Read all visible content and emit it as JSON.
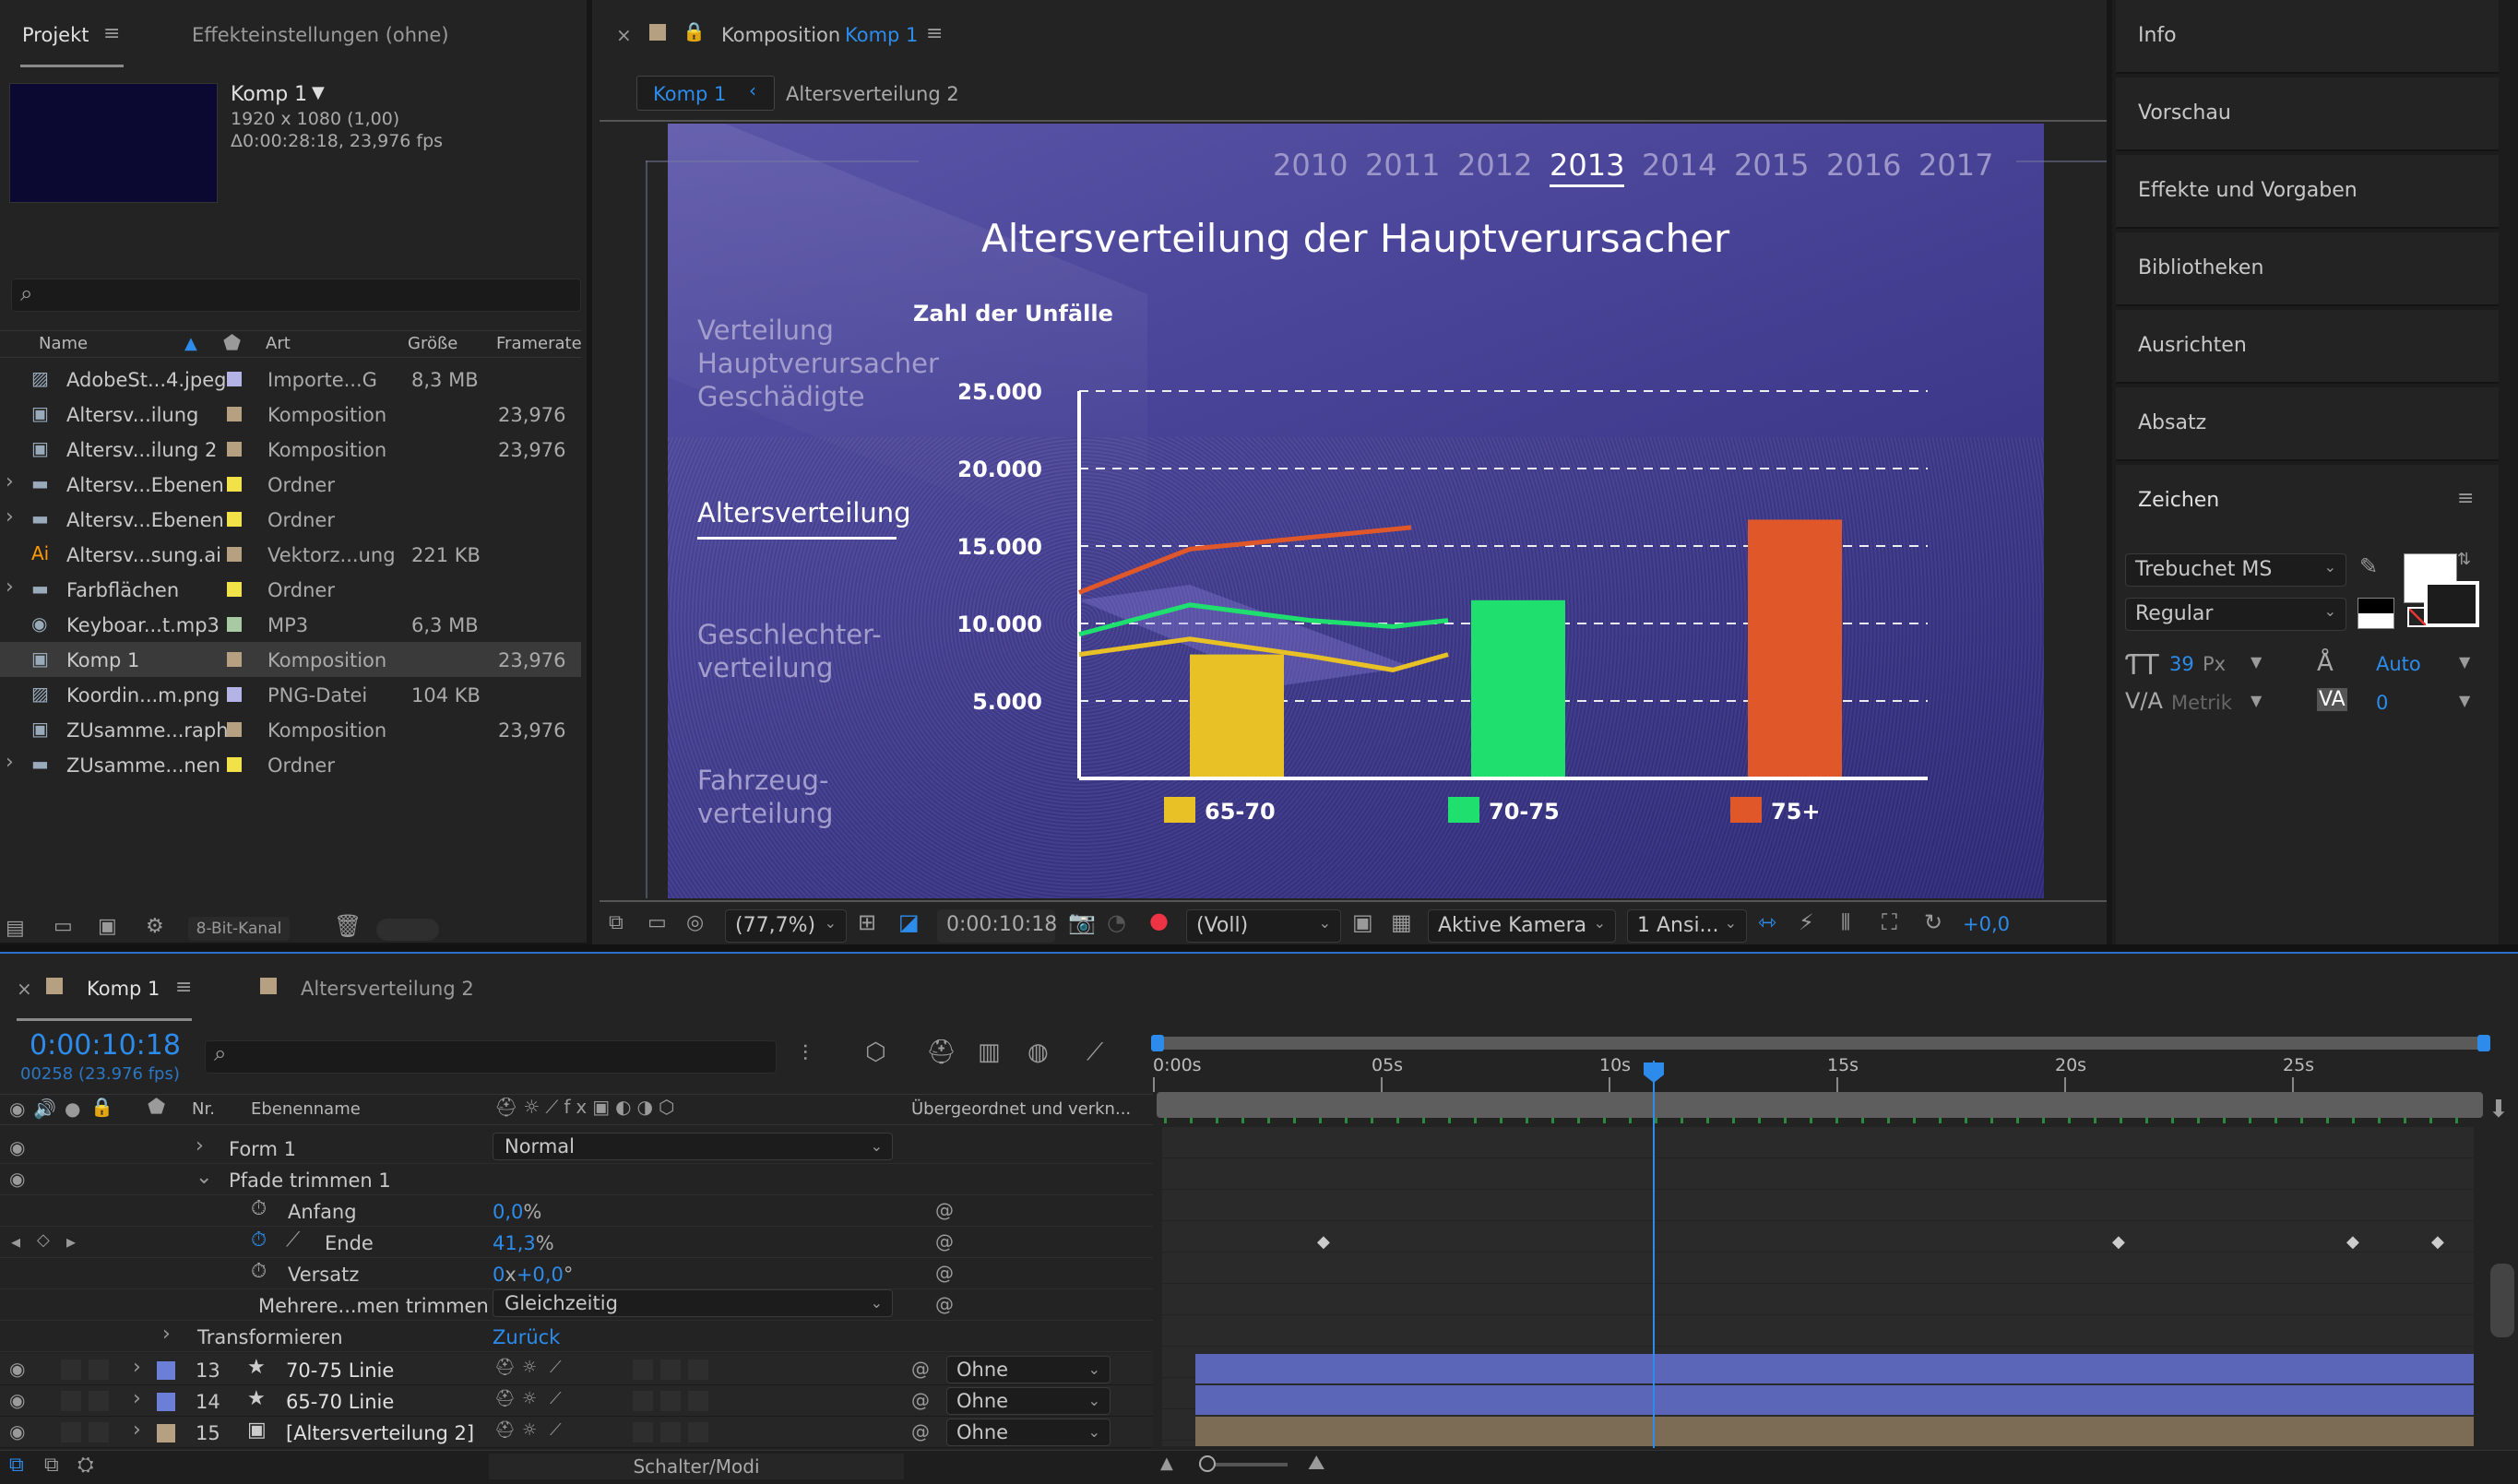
{
  "project_panel": {
    "tab_project": "Projekt",
    "tab_effects": "Effekteinstellungen (ohne)",
    "comp_name": "Komp 1",
    "comp_res": "1920 x 1080 (1,00)",
    "comp_duration": "Δ0:00:28:18, 23,976 fps",
    "columns": {
      "name": "Name",
      "type": "Art",
      "size": "Größe",
      "framerate": "Framerate"
    },
    "items": [
      {
        "name": "AdobeSt...4.jpeg",
        "type": "Importe...G",
        "size": "8,3 MB",
        "fps": "",
        "color": "#b3b3e6",
        "icon": "image-icon"
      },
      {
        "name": "Altersv...ilung",
        "type": "Komposition",
        "size": "",
        "fps": "23,976",
        "color": "#b6a082",
        "icon": "composition-icon"
      },
      {
        "name": "Altersv...ilung 2",
        "type": "Komposition",
        "size": "",
        "fps": "23,976",
        "color": "#b6a082",
        "icon": "composition-icon"
      },
      {
        "name": "Altersv...Ebenen",
        "type": "Ordner",
        "size": "",
        "fps": "",
        "color": "#f2e24a",
        "icon": "folder-icon"
      },
      {
        "name": "Altersv...Ebenen",
        "type": "Ordner",
        "size": "",
        "fps": "",
        "color": "#f2e24a",
        "icon": "folder-icon"
      },
      {
        "name": "Altersv...sung.ai",
        "type": "Vektorz...ung",
        "size": "221 KB",
        "fps": "",
        "color": "#b6a082",
        "icon": "illustrator-file-icon"
      },
      {
        "name": "Farbflächen",
        "type": "Ordner",
        "size": "",
        "fps": "",
        "color": "#f2e24a",
        "icon": "folder-icon"
      },
      {
        "name": "Keyboar...t.mp3",
        "type": "MP3",
        "size": "6,3 MB",
        "fps": "",
        "color": "#a9c9a5",
        "icon": "audio-icon"
      },
      {
        "name": "Komp 1",
        "type": "Komposition",
        "size": "",
        "fps": "23,976",
        "color": "#b6a082",
        "icon": "composition-icon"
      },
      {
        "name": "Koordin...m.png",
        "type": "PNG-Datei",
        "size": "104 KB",
        "fps": "",
        "color": "#b3b3e6",
        "icon": "image-icon"
      },
      {
        "name": "ZUsamme...raph",
        "type": "Komposition",
        "size": "",
        "fps": "23,976",
        "color": "#b6a082",
        "icon": "composition-icon"
      },
      {
        "name": "ZUsamme...nen",
        "type": "Ordner",
        "size": "",
        "fps": "",
        "color": "#f2e24a",
        "icon": "folder-icon"
      }
    ],
    "bit_depth": "8-Bit-Kanal"
  },
  "viewer": {
    "tab_label": "Komposition",
    "tab_comp": "Komp 1",
    "breadcrumb_active": "Komp 1",
    "breadcrumb_next": "Altersverteilung 2",
    "zoom": "(77,7%)",
    "timecode": "0:00:10:18",
    "resolution": "(Voll)",
    "camera": "Aktive Kamera",
    "views": "1 Ansi...",
    "exposure": "+0,0"
  },
  "comp_content": {
    "years": [
      "2010",
      "2011",
      "2012",
      "2013",
      "2014",
      "2015",
      "2016",
      "2017"
    ],
    "active_year": "2013",
    "title": "Altersverteilung der Hauptverursacher",
    "menu": [
      "Verteilung Hauptverursacher Geschädigte",
      "Altersverteilung",
      "Geschlechter-verteilung",
      "Fahrzeug-verteilung"
    ],
    "menu_lines": [
      [
        "Verteilung",
        "Hauptverursacher",
        "Geschädigte"
      ],
      [
        "Altersverteilung"
      ],
      [
        "Geschlechter-",
        "verteilung"
      ],
      [
        "Fahrzeug-",
        "verteilung"
      ]
    ]
  },
  "chart_data": {
    "type": "bar",
    "ylabel": "Zahl der Unfälle",
    "ylim": [
      0,
      25000
    ],
    "yticks": [
      "25.000",
      "20.000",
      "15.000",
      "10.000",
      "5.000"
    ],
    "ytick_values": [
      25000,
      20000,
      15000,
      10000,
      5000
    ],
    "categories": [
      "65-70",
      "70-75",
      "75+"
    ],
    "values": [
      8000,
      11500,
      16700
    ],
    "colors": [
      "#e8c126",
      "#1fe06e",
      "#e0582a"
    ],
    "lines": [
      {
        "color": "#e0582a",
        "points": [
          12000,
          14800,
          16200
        ]
      },
      {
        "color": "#1fe06e",
        "points": [
          9300,
          11200,
          10200,
          9800,
          10200
        ]
      },
      {
        "color": "#e8c126",
        "points": [
          8000,
          9000,
          7900,
          7000,
          8000
        ]
      }
    ]
  },
  "right_panel": {
    "items": [
      "Info",
      "Vorschau",
      "Effekte und Vorgaben",
      "Bibliotheken",
      "Ausrichten",
      "Absatz"
    ],
    "character_title": "Zeichen",
    "font": "Trebuchet MS",
    "style": "Regular",
    "font_size": "39",
    "font_size_unit": "Px",
    "leading": "Auto",
    "kerning": "Metrik",
    "tracking": "0"
  },
  "timeline": {
    "tab_active": "Komp 1",
    "tab_other": "Altersverteilung 2",
    "timecode": "0:00:10:18",
    "frame_info": "00258 (23.976 fps)",
    "col_nr": "Nr.",
    "col_layer": "Ebenenname",
    "col_parent": "Übergeordnet und verkn...",
    "ruler": [
      "0:00s",
      "05s",
      "10s",
      "15s",
      "20s",
      "25s"
    ],
    "properties": [
      {
        "name": "Form 1",
        "value": "Normal"
      },
      {
        "name": "Pfade trimmen 1",
        "value": ""
      },
      {
        "name": "Anfang",
        "value": "0,0",
        "unit": "%"
      },
      {
        "name": "Ende",
        "value": "41,3",
        "unit": "%"
      },
      {
        "name": "Versatz",
        "value": "0",
        "unit2": "x",
        "value2": "+0,0",
        "unit3": "°"
      },
      {
        "name": "Mehrere...men trimmen",
        "value": "Gleichzeitig"
      },
      {
        "name": "Transformieren",
        "value": "Zurück"
      }
    ],
    "layers": [
      {
        "nr": "13",
        "name": "70-75 Linie",
        "parent": "Ohne",
        "color": "#6b7fd6"
      },
      {
        "nr": "14",
        "name": "65-70 Linie",
        "parent": "Ohne",
        "color": "#6b7fd6"
      },
      {
        "nr": "15",
        "name": "[Altersverteilung 2]",
        "parent": "Ohne",
        "color": "#b6a082"
      }
    ],
    "switch_modes": "Schalter/Modi"
  }
}
